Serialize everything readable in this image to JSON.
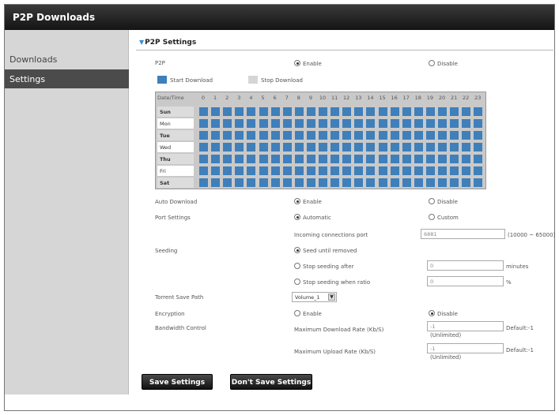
{
  "window": {
    "title": "P2P Downloads"
  },
  "sidebar": {
    "items": [
      {
        "label": "Downloads"
      },
      {
        "label": "Settings"
      }
    ]
  },
  "section": {
    "title": "P2P Settings"
  },
  "p2p": {
    "label": "P2P",
    "enable": "Enable",
    "disable": "Disable"
  },
  "legend": {
    "start": "Start Download",
    "stop": "Stop Download",
    "start_color": "#3f7fba",
    "stop_color": "#d5d5d5"
  },
  "schedule": {
    "corner": "Date/Time",
    "hours": [
      "0",
      "1",
      "2",
      "3",
      "4",
      "5",
      "6",
      "7",
      "8",
      "9",
      "10",
      "11",
      "12",
      "13",
      "14",
      "15",
      "16",
      "17",
      "18",
      "19",
      "20",
      "21",
      "22",
      "23"
    ],
    "days": [
      "Sun",
      "Mon",
      "Tue",
      "Wed",
      "Thu",
      "Fri",
      "Sat"
    ]
  },
  "auto_download": {
    "label": "Auto Download",
    "enable": "Enable",
    "disable": "Disable"
  },
  "port": {
    "label": "Port Settings",
    "automatic": "Automatic",
    "custom": "Custom",
    "incoming_label": "Incoming connections port",
    "incoming_value": "6881",
    "range": "(10000 ~ 65000)"
  },
  "seeding": {
    "label": "Seeding",
    "opt1": "Seed until removed",
    "opt2": "Stop seeding after",
    "opt2_value": "0",
    "opt2_unit": "minutes",
    "opt3": "Stop seeding when ratio",
    "opt3_value": "0",
    "opt3_unit": "%"
  },
  "torrent": {
    "label": "Torrent Save Path",
    "value": "Volume_1"
  },
  "encryption": {
    "label": "Encryption",
    "enable": "Enable",
    "disable": "Disable"
  },
  "bandwidth": {
    "label": "Bandwidth Control",
    "download_label": "Maximum Download Rate (Kb/S)",
    "download_value": "-1",
    "download_default": "Default:-1",
    "download_unlimited": "(Unlimited)",
    "upload_label": "Maximum Upload Rate (Kb/S)",
    "upload_value": "-1",
    "upload_default": "Default:-1",
    "upload_unlimited": "(Unlimited)"
  },
  "buttons": {
    "save": "Save Settings",
    "dont_save": "Don't Save Settings"
  }
}
